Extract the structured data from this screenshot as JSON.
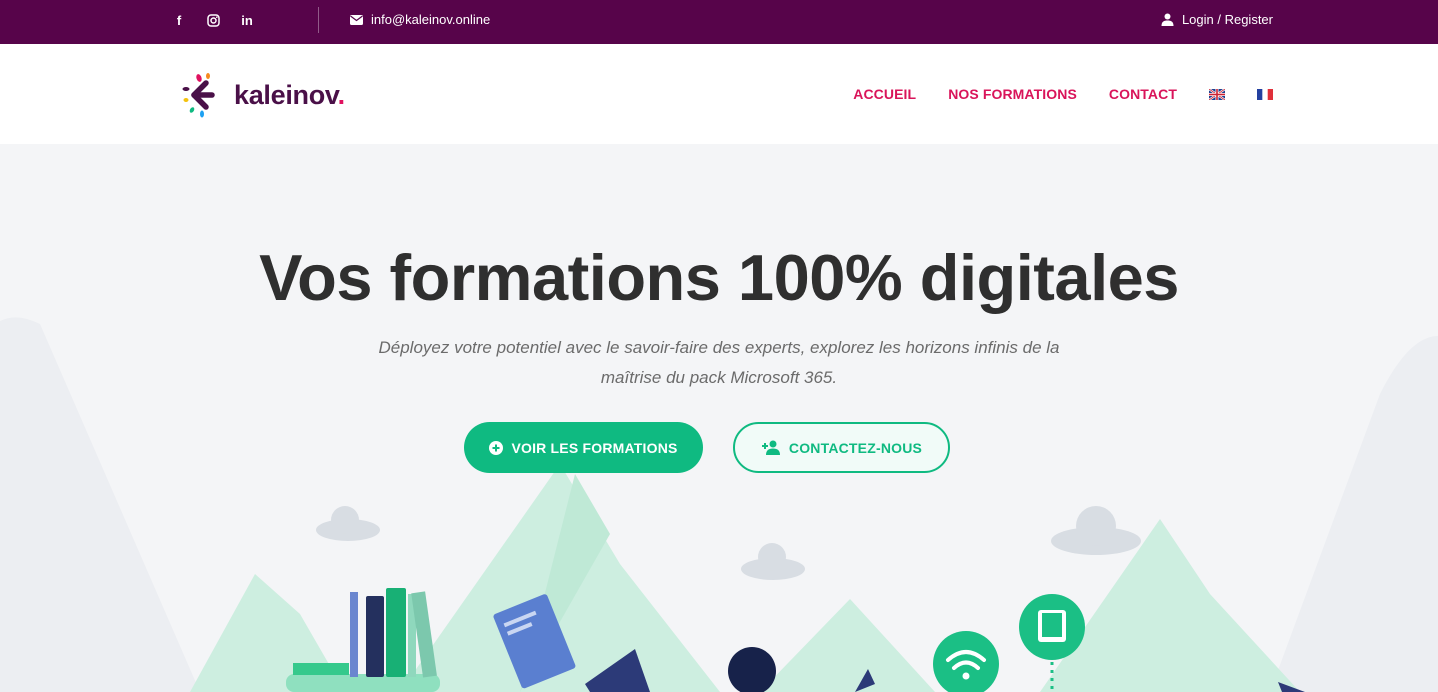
{
  "topbar": {
    "social": [
      {
        "icon": "facebook-icon",
        "glyph": "f"
      },
      {
        "icon": "instagram-icon",
        "glyph": "◎"
      },
      {
        "icon": "linkedin-icon",
        "glyph": "in"
      }
    ],
    "email": "info@kaleinov.online",
    "login": "Login / Register"
  },
  "header": {
    "logo_text": "kaleinov",
    "logo_dot": ".",
    "nav": [
      "ACCUEIL",
      "NOS FORMATIONS",
      "CONTACT"
    ],
    "languages": [
      "en-flag-icon",
      "fr-flag-icon"
    ]
  },
  "hero": {
    "title": "Vos formations 100% digitales",
    "subtitle_line1": "Déployez votre potentiel avec le savoir-faire des experts, explorez les horizons infinis de la",
    "subtitle_line2": "maîtrise du pack Microsoft 365.",
    "primary_button": "VOIR LES FORMATIONS",
    "secondary_button": "CONTACTEZ-NOUS"
  },
  "colors": {
    "topbar": "#57044a",
    "nav": "#d9145a",
    "accent": "#0fba81",
    "title": "#2f2f2f"
  }
}
